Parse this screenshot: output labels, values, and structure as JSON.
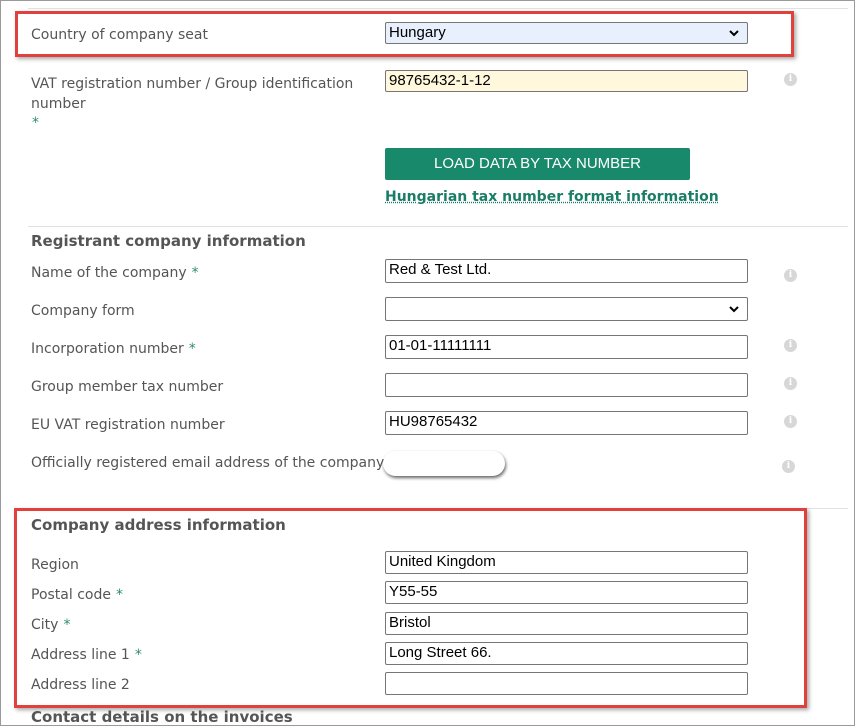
{
  "seat": {
    "label": "Country of company seat",
    "value": "Hungary"
  },
  "vat": {
    "label": "VAT registration number / Group identification",
    "label_line2": "number",
    "required_mark": "*",
    "value": "98765432-1-12",
    "button": "LOAD DATA BY TAX NUMBER",
    "link": "Hungarian tax number format information"
  },
  "registrant": {
    "title": "Registrant company information",
    "company_name": {
      "label": "Name of the company",
      "required_mark": "*",
      "value": "Red & Test Ltd."
    },
    "company_form": {
      "label": "Company form",
      "value": ""
    },
    "incorporation": {
      "label": "Incorporation number",
      "required_mark": "*",
      "value": "01-01-11111111"
    },
    "group_member": {
      "label": "Group member tax number",
      "value": ""
    },
    "eu_vat": {
      "label": "EU VAT registration number",
      "value": "HU98765432"
    },
    "email": {
      "label": "Officially registered email address of the company",
      "value": ""
    }
  },
  "address": {
    "title": "Company address information",
    "region": {
      "label": "Region",
      "value": "United Kingdom"
    },
    "postal": {
      "label": "Postal code",
      "required_mark": "*",
      "value": "Y55-55"
    },
    "city": {
      "label": "City",
      "required_mark": "*",
      "value": "Bristol"
    },
    "line1": {
      "label": "Address line 1",
      "required_mark": "*",
      "value": "Long Street 66."
    },
    "line2": {
      "label": "Address line 2",
      "value": ""
    }
  },
  "contact": {
    "title": "Contact details on the invoices"
  },
  "icons": {
    "info": "i",
    "dropdown": "chevron-down-icon"
  },
  "colors": {
    "accent": "#19896b",
    "required": "#2e8b72",
    "highlight": "#e0413d"
  }
}
